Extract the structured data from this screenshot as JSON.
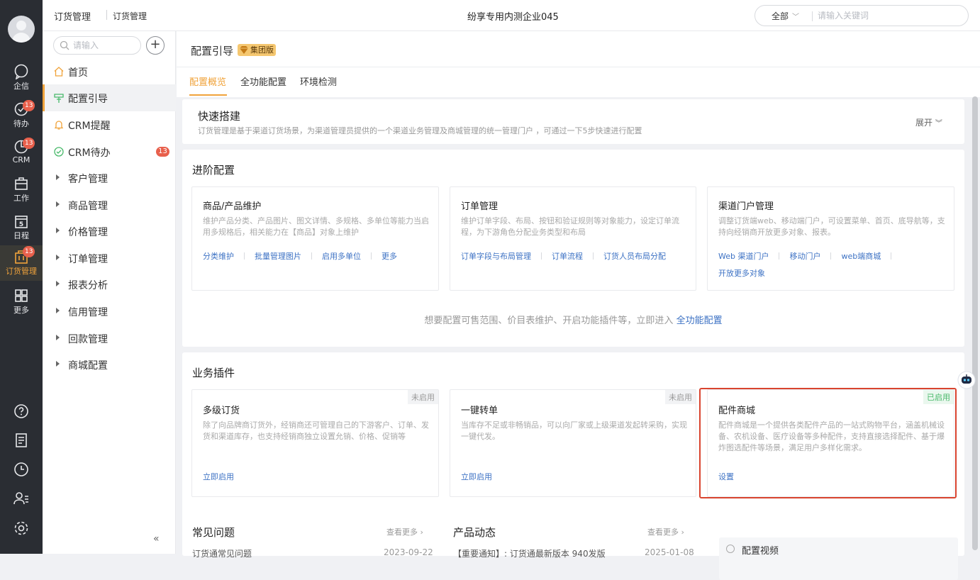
{
  "rail": {
    "items": [
      {
        "label": "企信",
        "icon": "chat-icon"
      },
      {
        "label": "待办",
        "icon": "check-circle-icon",
        "badge": "13"
      },
      {
        "label": "CRM",
        "icon": "crm-icon",
        "badge": "13"
      },
      {
        "label": "工作",
        "icon": "work-icon"
      },
      {
        "label": "日程",
        "icon": "calendar-icon",
        "day": "5"
      },
      {
        "label": "订货管理",
        "icon": "order-icon",
        "badge": "13"
      },
      {
        "label": "更多",
        "icon": "grid-icon"
      }
    ],
    "bottom_icons": [
      "help-icon",
      "notes-icon",
      "clock-icon",
      "user-list-icon",
      "settings-icon"
    ]
  },
  "topbar": {
    "crumb_app": "订货管理",
    "crumb_page": "订货管理",
    "company": "纷享专用内测企业045",
    "search_scope": "全部",
    "search_placeholder": "请输入关键词"
  },
  "sidebar": {
    "search_placeholder": "请输入",
    "items": [
      {
        "label": "首页",
        "icon": "home-icon"
      },
      {
        "label": "配置引导",
        "icon": "guide-icon"
      },
      {
        "label": "CRM提醒",
        "icon": "bell-icon"
      },
      {
        "label": "CRM待办",
        "icon": "check-circle-icon",
        "badge": "13"
      },
      {
        "label": "客户管理"
      },
      {
        "label": "商品管理"
      },
      {
        "label": "价格管理"
      },
      {
        "label": "订单管理"
      },
      {
        "label": "报表分析"
      },
      {
        "label": "信用管理"
      },
      {
        "label": "回款管理"
      },
      {
        "label": "商城配置"
      }
    ],
    "collapse": "«"
  },
  "page": {
    "title": "配置引导",
    "version_badge": "集团版",
    "tabs": [
      "配置概览",
      "全功能配置",
      "环境检测"
    ]
  },
  "quick": {
    "title": "快速搭建",
    "desc": "订货管理是基于渠道订货场景，为渠道管理员提供的一个渠道业务管理及商城管理的统一管理门户 ，可通过一下5步快速进行配置",
    "expand": "展开"
  },
  "advanced": {
    "title": "进阶配置",
    "cards": [
      {
        "title": "商品/产品维护",
        "desc": "维护产品分类、产品图片、图文详情、多规格、多单位等能力当启用多规格后，相关能力在【商品】对象上维护",
        "links": [
          "分类维护",
          "批量管理图片",
          "启用多单位",
          "更多"
        ]
      },
      {
        "title": "订单管理",
        "desc": "维护订单字段、布局、按钮和验证规则等对象能力，设定订单流程，为下游角色分配业务类型和布局",
        "links": [
          "订单字段与布局管理",
          "订单流程",
          "订货人员布局分配"
        ]
      },
      {
        "title": "渠道门户管理",
        "desc": "调整订货端web、移动端门户，可设置菜单、首页、底导航等，支持向经销商开放更多对象、报表。",
        "links": [
          "Web 渠道门户",
          "移动门户",
          "web端商城"
        ],
        "links2": [
          "开放更多对象"
        ]
      }
    ],
    "hint_prefix": "想要配置可售范围、价目表维护、开启功能插件等，立即进入",
    "hint_link": "全功能配置"
  },
  "plugins": {
    "title": "业务插件",
    "cards": [
      {
        "title": "多级订货",
        "status": "未启用",
        "desc": "除了向品牌商订货外，经销商还可管理自己的下游客户、订单、发货和渠道库存，也支持经销商独立设置允销、价格、促销等",
        "action": "立即启用"
      },
      {
        "title": "一键转单",
        "status": "未启用",
        "desc": "当库存不足或非畅销品，可以向厂家或上级渠道发起转采购，实现一键代发。",
        "action": "立即启用"
      },
      {
        "title": "配件商城",
        "status": "已启用",
        "desc": "配件商城是一个提供各类配件产品的一站式购物平台，涵盖机械设备、农机设备、医疗设备等多种配件，支持直接选择配件、基于爆炸图选配件等场景，满足用户多样化需求。",
        "action": "设置"
      }
    ]
  },
  "bottom": {
    "faq_title": "常见问题",
    "faq_more": "查看更多",
    "faq_row": "订货通常见问题",
    "faq_date": "2023-09-22",
    "news_title": "产品动态",
    "news_more": "查看更多",
    "news_row": "【重要通知】: 订货通最新版本 940发版",
    "news_date": "2025-01-08",
    "video_title": "配置视频"
  },
  "colors": {
    "accent": "#f0a33b",
    "link": "#3d72c4",
    "badge": "#e8604c",
    "enabled": "#48b96a",
    "highlight_box": "#d9442f"
  }
}
